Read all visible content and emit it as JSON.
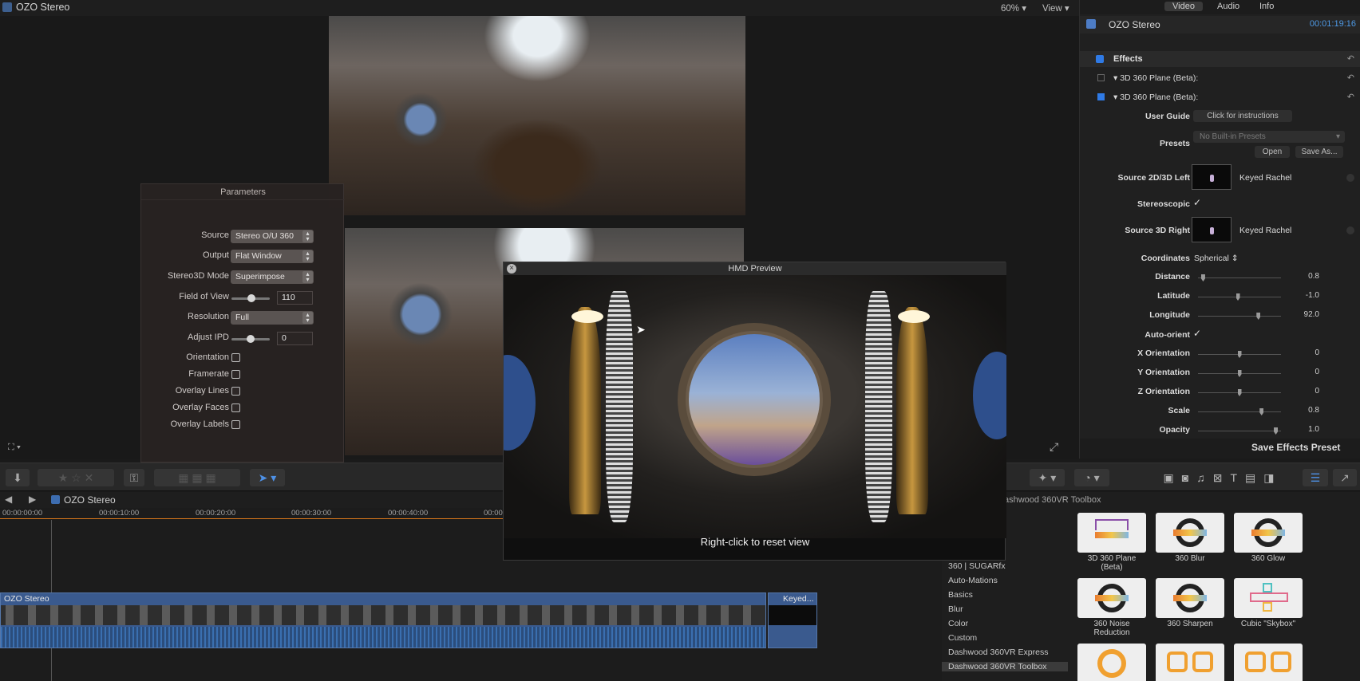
{
  "app": {
    "title": "OZO Stereo",
    "zoom": "60%",
    "view_label": "View"
  },
  "parameters": {
    "title": "Parameters",
    "rows": [
      {
        "label": "Source",
        "value": "Stereo O/U 360"
      },
      {
        "label": "Output",
        "value": "Flat Window"
      },
      {
        "label": "Stereo3D Mode",
        "value": "Superimpose"
      },
      {
        "label": "Field of View",
        "value": "110"
      },
      {
        "label": "Resolution",
        "value": "Full"
      },
      {
        "label": "Adjust IPD",
        "value": "0"
      },
      {
        "label": "Orientation"
      },
      {
        "label": "Framerate"
      },
      {
        "label": "Overlay Lines"
      },
      {
        "label": "Overlay Faces"
      },
      {
        "label": "Overlay Labels"
      }
    ]
  },
  "hmd": {
    "title": "HMD Preview",
    "caption": "Right-click to reset view"
  },
  "inspector": {
    "tabs": [
      "Video",
      "Audio",
      "Info"
    ],
    "clip_name": "OZO Stereo",
    "clip_time": "00:01:19:16",
    "effects_label": "Effects",
    "effect_1": "3D 360 Plane (Beta):",
    "effect_2": "3D 360 Plane (Beta):",
    "user_guide_label": "User Guide",
    "user_guide_button": "Click for instructions",
    "presets_label": "Presets",
    "presets_value": "No Built-in Presets",
    "open_button": "Open",
    "save_as_button": "Save As...",
    "source_left_label": "Source 2D/3D Left",
    "source_left_value": "Keyed Rachel",
    "stereoscopic_label": "Stereoscopic",
    "source_right_label": "Source 3D Right",
    "source_right_value": "Keyed Rachel",
    "coordinates_label": "Coordinates",
    "coordinates_value": "Spherical",
    "sliders": [
      {
        "label": "Distance",
        "value": "0.8",
        "pos": 0.04
      },
      {
        "label": "Latitude",
        "value": "-1.0",
        "pos": 0.48
      },
      {
        "label": "Longitude",
        "value": "92.0",
        "pos": 0.74
      }
    ],
    "auto_orient_label": "Auto-orient",
    "orient_sliders": [
      {
        "label": "X Orientation",
        "value": "0",
        "pos": 0.5
      },
      {
        "label": "Y Orientation",
        "value": "0",
        "pos": 0.5
      },
      {
        "label": "Z Orientation",
        "value": "0",
        "pos": 0.5
      },
      {
        "label": "Scale",
        "value": "0.8",
        "pos": 0.78
      },
      {
        "label": "Opacity",
        "value": "1.0",
        "pos": 0.96
      }
    ],
    "save_effects_preset": "Save Effects Preset"
  },
  "timeline": {
    "name": "OZO Stereo",
    "ticks": [
      "00:00:00:00",
      "00:00:10:00",
      "00:00:20:00",
      "00:00:30:00",
      "00:00:40:00",
      "00:00"
    ],
    "clip_main": "OZO Stereo",
    "clip_keyed": "Keyed..."
  },
  "effects_browser": {
    "title": "ashwood 360VR Toolbox",
    "categories": [
      "360 | SUGARfx",
      "Auto-Mations",
      "Basics",
      "Blur",
      "Color",
      "Custom",
      "Dashwood 360VR Express",
      "Dashwood 360VR Toolbox"
    ],
    "items": [
      {
        "name": "3D 360 Plane (Beta)"
      },
      {
        "name": "360 Blur"
      },
      {
        "name": "360 Glow"
      },
      {
        "name": "360 Noise Reduction"
      },
      {
        "name": "360 Sharpen"
      },
      {
        "name": "Cubic \"Skybox\""
      }
    ]
  }
}
